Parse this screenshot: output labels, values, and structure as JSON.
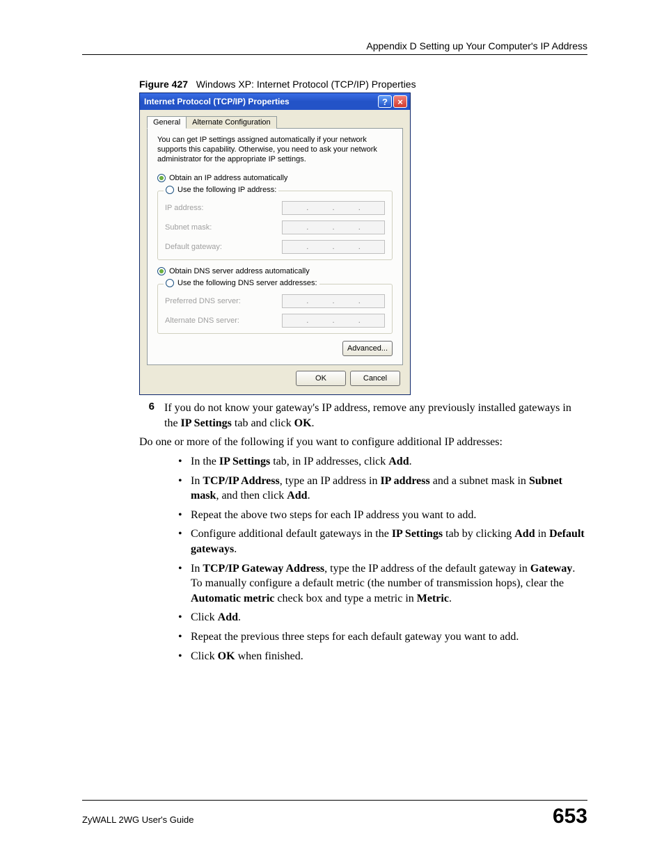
{
  "header": {
    "running": "Appendix D Setting up Your Computer's IP Address"
  },
  "figure": {
    "number": "Figure 427",
    "caption": "Windows XP: Internet Protocol (TCP/IP) Properties"
  },
  "dialog": {
    "title": "Internet Protocol (TCP/IP) Properties",
    "tabs": {
      "general": "General",
      "alt": "Alternate Configuration"
    },
    "desc": "You can get IP settings assigned automatically if your network supports this capability. Otherwise, you need to ask your network administrator for the appropriate IP settings.",
    "radio_ip_auto": "Obtain an IP address automatically",
    "radio_ip_manual": "Use the following IP address:",
    "lbl_ip": "IP address:",
    "lbl_subnet": "Subnet mask:",
    "lbl_gateway": "Default gateway:",
    "radio_dns_auto": "Obtain DNS server address automatically",
    "radio_dns_manual": "Use the following DNS server addresses:",
    "lbl_pref_dns": "Preferred DNS server:",
    "lbl_alt_dns": "Alternate DNS server:",
    "btn_advanced": "Advanced...",
    "btn_ok": "OK",
    "btn_cancel": "Cancel"
  },
  "step": {
    "num": "6",
    "t1": "If you do not know your gateway's IP address, remove any previously installed gateways in the ",
    "b1": "IP Settings",
    "t2": " tab and click ",
    "b2": "OK",
    "t3": "."
  },
  "para1": "Do one or more of the following if you want to configure additional IP addresses:",
  "bullets": [
    {
      "parts": [
        "In the ",
        "IP Settings",
        " tab, in IP addresses, click ",
        "Add",
        "."
      ]
    },
    {
      "parts": [
        "In ",
        "TCP/IP Address",
        ", type an IP address in ",
        "IP address",
        " and a subnet mask in ",
        "Subnet mask",
        ", and then click ",
        "Add",
        "."
      ]
    },
    {
      "parts": [
        "Repeat the above two steps for each IP address you want to add."
      ]
    },
    {
      "parts": [
        "Configure additional default gateways in the ",
        "IP Settings",
        " tab by clicking ",
        "Add",
        " in ",
        "Default gateways",
        "."
      ]
    },
    {
      "parts": [
        "In ",
        "TCP/IP Gateway Address",
        ", type the IP address of the default gateway in ",
        "Gateway",
        ". To manually configure a default metric (the number of transmission hops), clear the ",
        "Automatic metric",
        " check box and type a metric in ",
        "Metric",
        "."
      ]
    },
    {
      "parts": [
        "Click ",
        "Add",
        "."
      ]
    },
    {
      "parts": [
        "Repeat the previous three steps for each default gateway you want to add."
      ]
    },
    {
      "parts": [
        "Click ",
        "OK",
        " when finished."
      ]
    }
  ],
  "footer": {
    "guide": "ZyWALL 2WG User's Guide",
    "page": "653"
  }
}
